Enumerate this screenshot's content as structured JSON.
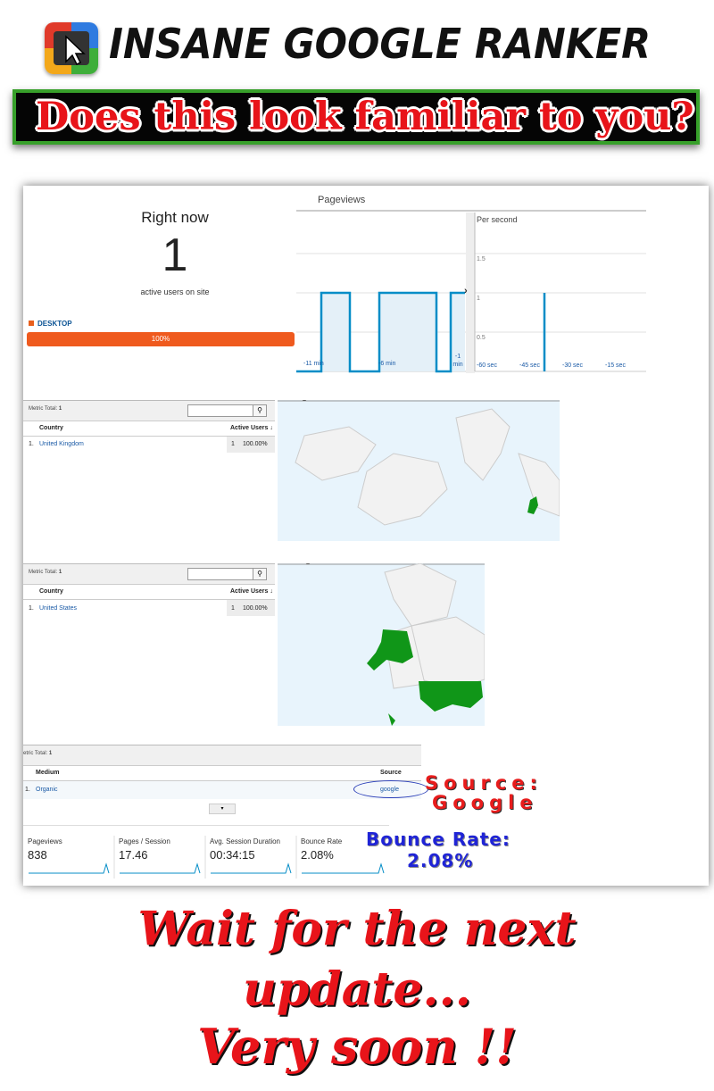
{
  "header": {
    "title": "Insane Google Ranker",
    "tagline": "Does this look familiar to you?"
  },
  "realtime": {
    "title": "Right now",
    "count": "1",
    "subtitle": "active users on site",
    "device_label": "DESKTOP",
    "device_percent": "100%"
  },
  "pageviews": {
    "title": "Pageviews",
    "per_second_label": "Per second",
    "y_ticks": [
      "1.5",
      "1",
      "0.5"
    ],
    "minute_ticks": [
      "-11 min",
      "-6 min",
      "-1 min"
    ],
    "second_ticks": [
      "-60 sec",
      "-45 sec",
      "-30 sec",
      "-15 sec"
    ]
  },
  "uk_table": {
    "metric_total_label": "Metric Total:",
    "metric_total": "1",
    "col_country": "Country",
    "col_users": "Active Users ↓",
    "rows": [
      {
        "index": "1.",
        "country": "United Kingdom",
        "users": "1",
        "percent": "100.00%"
      }
    ]
  },
  "us_table": {
    "metric_total_label": "Metric Total:",
    "metric_total": "1",
    "col_country": "Country",
    "col_users": "Active Users ↓",
    "rows": [
      {
        "index": "1.",
        "country": "United States",
        "users": "1",
        "percent": "100.00%"
      }
    ]
  },
  "source_table": {
    "metric_total_label": "etric Total:",
    "metric_total": "1",
    "col_medium": "Medium",
    "col_source": "Source",
    "rows": [
      {
        "index": "1.",
        "medium": "Organic",
        "source": "google"
      }
    ]
  },
  "metrics": [
    {
      "label": "Pageviews",
      "value": "838"
    },
    {
      "label": "Pages / Session",
      "value": "17.46"
    },
    {
      "label": "Avg. Session Duration",
      "value": "00:34:15"
    },
    {
      "label": "Bounce Rate",
      "value": "2.08%"
    }
  ],
  "annotations": {
    "source_line1": "Source:",
    "source_line2": "Google",
    "bounce_line1": "Bounce Rate:",
    "bounce_line2": "2.08%"
  },
  "footer": {
    "line1": "Wait for the next",
    "line2": "update...",
    "line3": "Very soon !!"
  },
  "colors": {
    "accent_orange": "#ef5a1e",
    "ga_blue": "#058dc7",
    "map_green": "#109618",
    "banner_green": "#37a02a",
    "headline_red": "#e8141a"
  },
  "icons": [
    "logo-cursor-icon",
    "search-icon",
    "chevron-right-icon"
  ]
}
